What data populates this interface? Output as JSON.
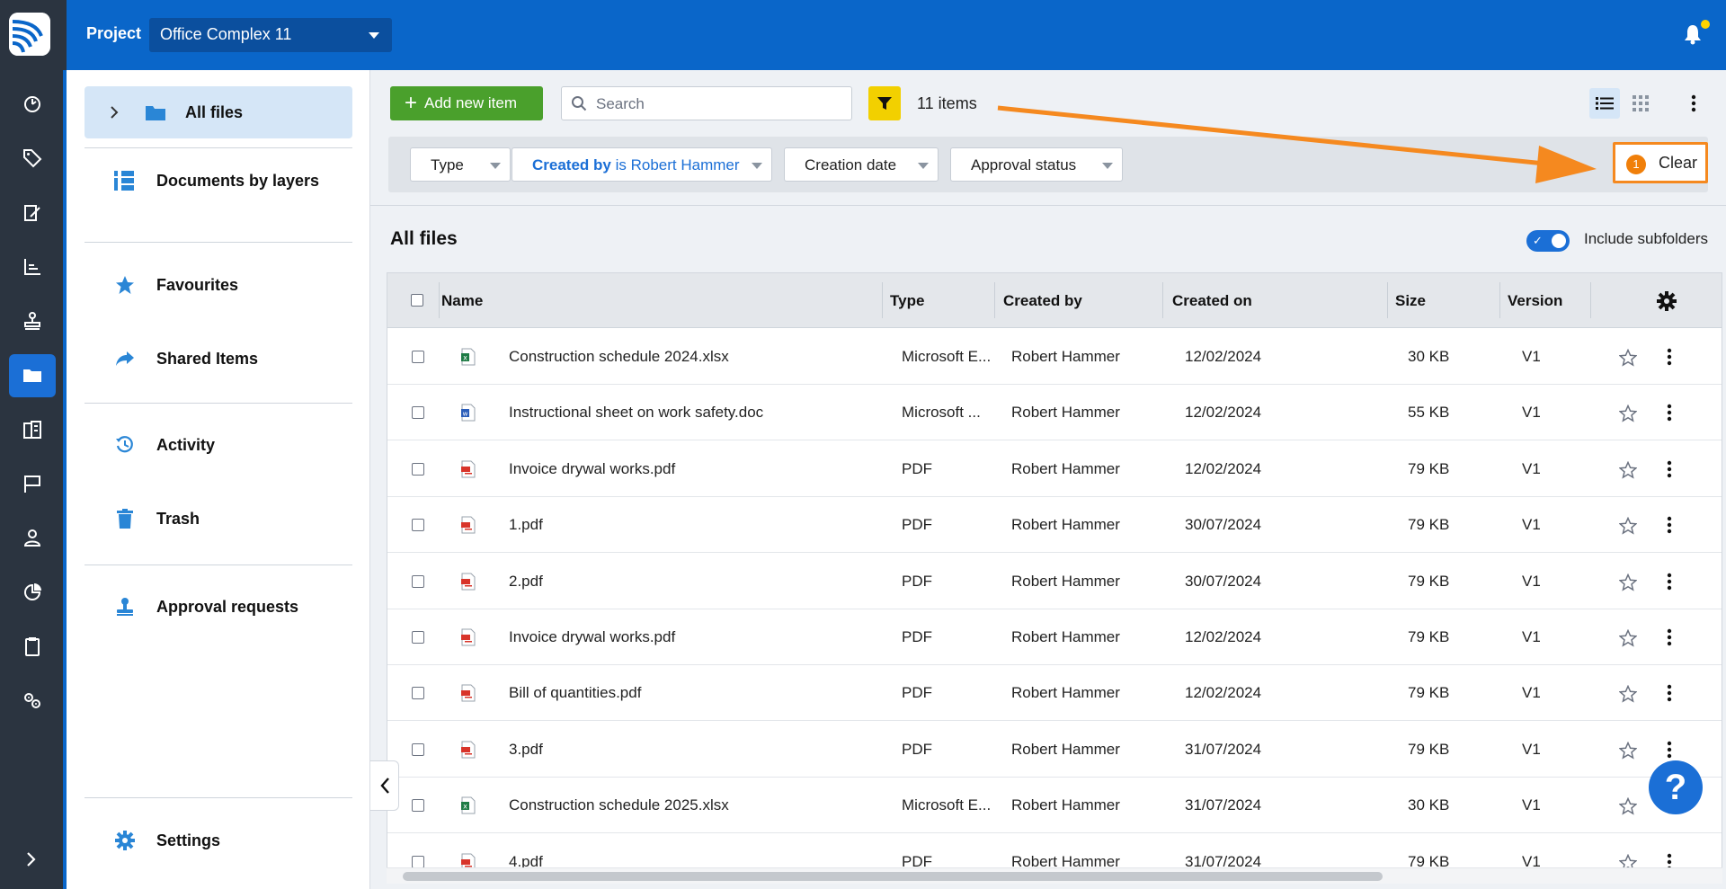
{
  "header": {
    "project_label": "Project",
    "project_name": "Office Complex 11"
  },
  "rail": {
    "items": [
      "dashboard-icon",
      "tag-icon",
      "sign-icon",
      "chart-icon",
      "stamp-icon",
      "folder-icon",
      "buildings-icon",
      "flag-icon",
      "user-icon",
      "pie-icon",
      "clipboard-icon",
      "settings-gears-icon"
    ],
    "active_index": 5
  },
  "nav": {
    "all_files": "All files",
    "documents_by_layers": "Documents by layers",
    "favourites": "Favourites",
    "shared_items": "Shared Items",
    "activity": "Activity",
    "trash": "Trash",
    "approval_requests": "Approval requests",
    "settings": "Settings"
  },
  "toolbar": {
    "add_label": "Add new item",
    "search_placeholder": "Search",
    "items_count": "11 items"
  },
  "filters": {
    "type": "Type",
    "created_by_key": "Created by",
    "created_by_value": "is Robert Hammer",
    "creation_date": "Creation date",
    "approval_status": "Approval status",
    "clear_count": "1",
    "clear_label": "Clear"
  },
  "section": {
    "title": "All files",
    "include_subfolders": "Include subfolders"
  },
  "table": {
    "columns": {
      "name": "Name",
      "type": "Type",
      "created_by": "Created by",
      "created_on": "Created on",
      "size": "Size",
      "version": "Version"
    },
    "rows": [
      {
        "icon": "excel",
        "name": "Construction schedule 2024.xlsx",
        "type": "Microsoft E...",
        "created_by": "Robert Hammer",
        "created_on": "12/02/2024",
        "size": "30 KB",
        "version": "V1"
      },
      {
        "icon": "word",
        "name": "Instructional sheet on work safety.doc",
        "type": "Microsoft ...",
        "created_by": "Robert Hammer",
        "created_on": "12/02/2024",
        "size": "55 KB",
        "version": "V1"
      },
      {
        "icon": "pdf",
        "name": "Invoice drywal works.pdf",
        "type": "PDF",
        "created_by": "Robert Hammer",
        "created_on": "12/02/2024",
        "size": "79 KB",
        "version": "V1"
      },
      {
        "icon": "pdf",
        "name": "1.pdf",
        "type": "PDF",
        "created_by": "Robert Hammer",
        "created_on": "30/07/2024",
        "size": "79 KB",
        "version": "V1"
      },
      {
        "icon": "pdf",
        "name": "2.pdf",
        "type": "PDF",
        "created_by": "Robert Hammer",
        "created_on": "30/07/2024",
        "size": "79 KB",
        "version": "V1"
      },
      {
        "icon": "pdf",
        "name": "Invoice drywal works.pdf",
        "type": "PDF",
        "created_by": "Robert Hammer",
        "created_on": "12/02/2024",
        "size": "79 KB",
        "version": "V1"
      },
      {
        "icon": "pdf",
        "name": "Bill of quantities.pdf",
        "type": "PDF",
        "created_by": "Robert Hammer",
        "created_on": "12/02/2024",
        "size": "79 KB",
        "version": "V1"
      },
      {
        "icon": "pdf",
        "name": "3.pdf",
        "type": "PDF",
        "created_by": "Robert Hammer",
        "created_on": "31/07/2024",
        "size": "79 KB",
        "version": "V1"
      },
      {
        "icon": "excel",
        "name": "Construction schedule 2025.xlsx",
        "type": "Microsoft E...",
        "created_by": "Robert Hammer",
        "created_on": "31/07/2024",
        "size": "30 KB",
        "version": "V1"
      },
      {
        "icon": "pdf",
        "name": "4.pdf",
        "type": "PDF",
        "created_by": "Robert Hammer",
        "created_on": "31/07/2024",
        "size": "79 KB",
        "version": "V1"
      }
    ]
  },
  "help_label": "?",
  "colors": {
    "brand_blue": "#0a66c9",
    "accent_orange": "#f5891f",
    "add_green": "#4aa02c",
    "filter_yellow": "#f2d000"
  }
}
